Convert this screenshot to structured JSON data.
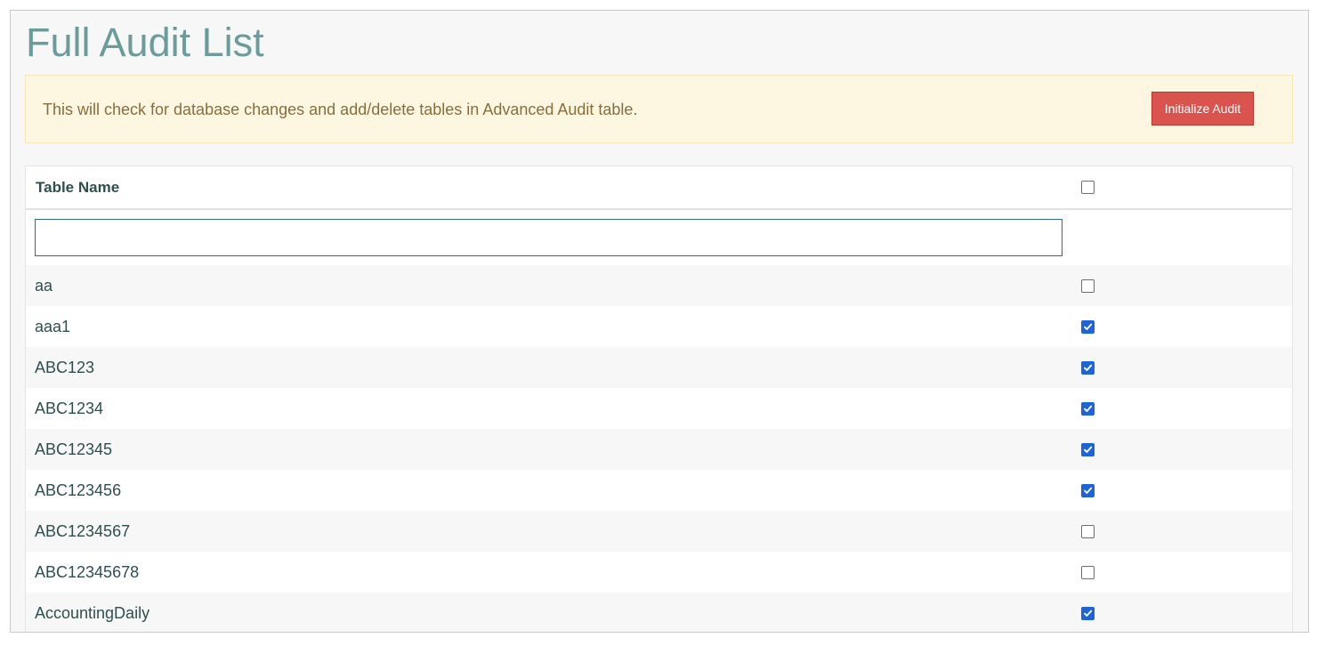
{
  "page": {
    "title": "Full Audit List"
  },
  "alert": {
    "message": "This will check for database changes and add/delete tables in Advanced Audit table.",
    "button_label": "Initialize Audit"
  },
  "table": {
    "header": {
      "name_label": "Table Name",
      "select_all_checked": false
    },
    "filter": {
      "value": "",
      "placeholder": ""
    },
    "rows": [
      {
        "name": "aa",
        "checked": false
      },
      {
        "name": "aaa1",
        "checked": true
      },
      {
        "name": "ABC123",
        "checked": true
      },
      {
        "name": "ABC1234",
        "checked": true
      },
      {
        "name": "ABC12345",
        "checked": true
      },
      {
        "name": "ABC123456",
        "checked": true
      },
      {
        "name": "ABC1234567",
        "checked": false
      },
      {
        "name": "ABC12345678",
        "checked": false
      },
      {
        "name": "AccountingDaily",
        "checked": true
      }
    ]
  },
  "colors": {
    "title": "#6a9c9c",
    "alert_bg": "#fdf7e2",
    "alert_text": "#8a6d3b",
    "danger_button": "#d9534f",
    "checkbox_checked": "#1f63d8"
  }
}
